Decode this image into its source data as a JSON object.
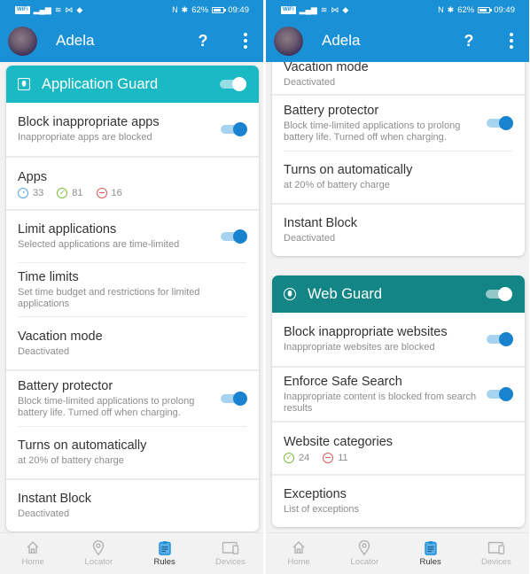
{
  "status_bar": {
    "wifi_tag": "WiFi",
    "signal": "all",
    "nfc": "N",
    "bluetooth": "✱",
    "battery_percent": "62%",
    "battery_level": 0.62,
    "time": "09:49"
  },
  "app_bar": {
    "user_name": "Adela",
    "help_label": "?",
    "more_label": "more options"
  },
  "left_screen": {
    "application_guard": {
      "title": "Application Guard",
      "icon": "lock-icon",
      "enabled": true,
      "rows": {
        "block_apps": {
          "title": "Block inappropriate apps",
          "subtitle": "Inappropriate apps are blocked",
          "enabled": true
        },
        "apps": {
          "title": "Apps",
          "time_limited": "33",
          "allowed": "81",
          "blocked": "16"
        },
        "limit_apps": {
          "title": "Limit applications",
          "subtitle": "Selected applications are time-limited",
          "enabled": true
        },
        "time_limits": {
          "title": "Time limits",
          "subtitle": "Set time budget and restrictions for limited applications"
        },
        "vacation": {
          "title": "Vacation mode",
          "subtitle": "Deactivated"
        },
        "battery": {
          "title": "Battery protector",
          "subtitle": "Block time-limited applications to prolong battery life. Turned off when charging.",
          "enabled": true
        },
        "turns_on": {
          "title": "Turns on automatically",
          "subtitle": "at 20% of battery charge"
        },
        "instant_block": {
          "title": "Instant Block",
          "subtitle": "Deactivated"
        }
      }
    }
  },
  "right_screen": {
    "application_guard_tail": {
      "vacation": {
        "title": "Vacation mode",
        "subtitle": "Deactivated"
      },
      "battery": {
        "title": "Battery protector",
        "subtitle": "Block time-limited applications to prolong battery life. Turned off when charging.",
        "enabled": true
      },
      "turns_on": {
        "title": "Turns on automatically",
        "subtitle": "at 20% of battery charge"
      },
      "instant_block": {
        "title": "Instant Block",
        "subtitle": "Deactivated"
      }
    },
    "web_guard": {
      "title": "Web Guard",
      "icon": "globe-lock-icon",
      "enabled": true,
      "rows": {
        "block_websites": {
          "title": "Block inappropriate websites",
          "subtitle": "Inappropriate websites are blocked",
          "enabled": true
        },
        "safe_search": {
          "title": "Enforce Safe Search",
          "subtitle": "Inappropriate content is blocked from search results",
          "enabled": true
        },
        "categories": {
          "title": "Website categories",
          "allowed": "24",
          "blocked": "11"
        },
        "exceptions": {
          "title": "Exceptions",
          "subtitle": "List of exceptions"
        }
      }
    }
  },
  "bottom_nav": {
    "items": [
      {
        "label": "Home",
        "icon": "home-icon",
        "active": false
      },
      {
        "label": "Locator",
        "icon": "location-pin-icon",
        "active": false
      },
      {
        "label": "Rules",
        "icon": "clipboard-icon",
        "active": true
      },
      {
        "label": "Devices",
        "icon": "devices-icon",
        "active": false
      }
    ]
  },
  "colors": {
    "app_bar": "#1a90d6",
    "application_guard_header": "#1ab9c4",
    "web_guard_header": "#138585",
    "toggle_on": "#1a83cf",
    "allowed": "#7cbf3a",
    "blocked": "#e05a5a",
    "time_limited": "#5aa5e0",
    "nav_active_icon": "#1a90d6"
  }
}
